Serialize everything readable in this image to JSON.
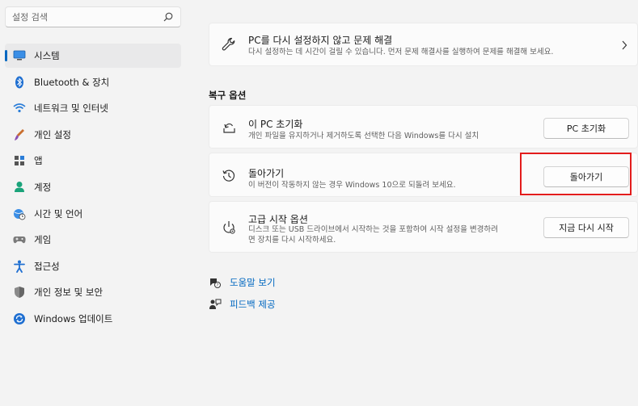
{
  "search": {
    "placeholder": "설정 검색"
  },
  "sidebar": {
    "items": [
      {
        "label": "시스템",
        "icon": "system-icon",
        "active": true
      },
      {
        "label": "Bluetooth & 장치",
        "icon": "bluetooth-icon"
      },
      {
        "label": "네트워크 및 인터넷",
        "icon": "wifi-icon"
      },
      {
        "label": "개인 설정",
        "icon": "brush-icon"
      },
      {
        "label": "앱",
        "icon": "apps-icon"
      },
      {
        "label": "계정",
        "icon": "account-icon"
      },
      {
        "label": "시간 및 언어",
        "icon": "globe-clock-icon"
      },
      {
        "label": "게임",
        "icon": "gamepad-icon"
      },
      {
        "label": "접근성",
        "icon": "accessibility-icon"
      },
      {
        "label": "개인 정보 및 보안",
        "icon": "shield-icon"
      },
      {
        "label": "Windows 업데이트",
        "icon": "update-icon"
      }
    ]
  },
  "troubleshoot": {
    "title": "PC를 다시 설정하지 않고 문제 해결",
    "desc": "다시 설정하는 데 시간이 걸릴 수 있습니다. 먼저 문제 해결사를 실행하여 문제를 해결해 보세요."
  },
  "recovery": {
    "section_label": "복구 옵션",
    "options": [
      {
        "title": "이 PC 초기화",
        "desc": "개인 파일을 유지하거나 제거하도록 선택한 다음 Windows를 다시 설치",
        "button": "PC 초기화"
      },
      {
        "title": "돌아가기",
        "desc": "이 버전이 작동하지 않는 경우 Windows 10으로 되돌려 보세요.",
        "button": "돌아가기"
      },
      {
        "title": "고급 시작 옵션",
        "desc_line1": "디스크 또는 USB 드라이브에서 시작하는 것을 포함하여 시작 설정을 변경하려",
        "desc_line2": "면 장치를 다시 시작하세요.",
        "button": "지금 다시 시작"
      }
    ]
  },
  "links": {
    "help": "도움말 보기",
    "feedback": "피드백 제공"
  },
  "colors": {
    "accent": "#0067c0",
    "highlight": "#e31c1c"
  }
}
